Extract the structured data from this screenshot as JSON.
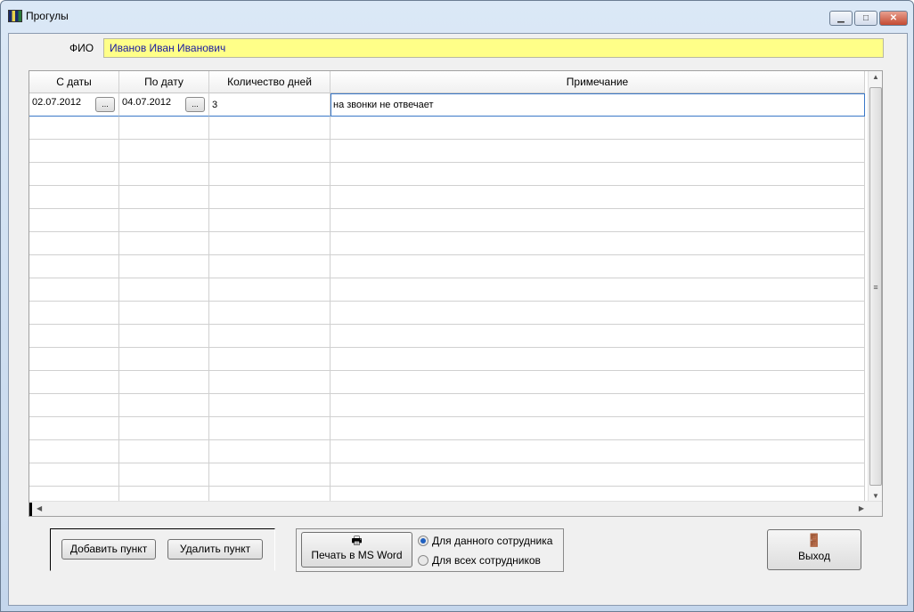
{
  "window": {
    "title": "Прогулы",
    "minimize": "▁",
    "maximize": "□",
    "close": "✕"
  },
  "fio": {
    "label": "ФИО",
    "value": "Иванов Иван Иванович"
  },
  "table": {
    "columns": [
      "С даты",
      "По дату",
      "Количество дней",
      "Примечание"
    ],
    "rows": [
      {
        "from": "02.07.2012",
        "to": "04.07.2012",
        "days": "3",
        "note": "на звонки не отвечает"
      }
    ],
    "picker_label": "..."
  },
  "buttons": {
    "add": "Добавить пункт",
    "delete": "Удалить пункт",
    "print": "Печать в MS Word",
    "exit": "Выход"
  },
  "print_options": {
    "current": "Для данного сотрудника",
    "all": "Для всех сотрудников",
    "selected": "current"
  }
}
